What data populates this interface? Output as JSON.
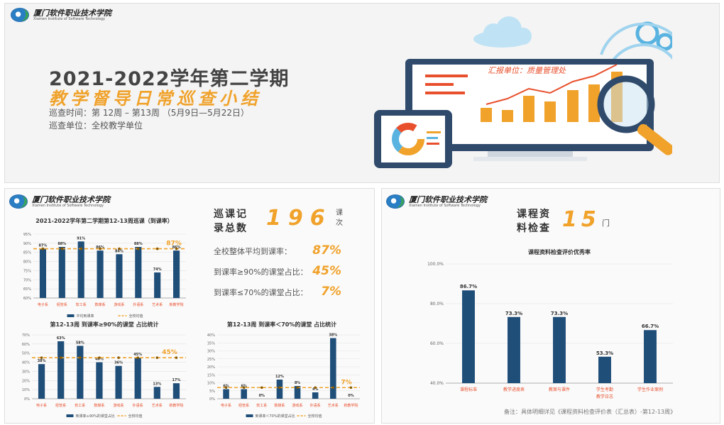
{
  "logo": {
    "cn": "厦门软件职业技术学院",
    "en": "Xiamen Institute of Software Technology"
  },
  "cover": {
    "title": "2021-2022学年第二学期",
    "subtitle": "教学督导日常巡查小结",
    "time_line": "巡查时间：第 12周 – 第13周 （5月9日—5月22日）",
    "unit_line": "巡查单位：全校教学单位",
    "screen_banner": "汇报单位：质量管理处"
  },
  "left_slide": {
    "stat_label": "巡课记录总数",
    "stat_value": "196",
    "stat_unit": "课次",
    "stats": [
      {
        "label": "全校整体平均到课率：",
        "value": "87%"
      },
      {
        "label": "到课率≥90%的课堂占比：",
        "value": "45%"
      },
      {
        "label": "到课率≤70%的课堂占比：",
        "value": "7%"
      }
    ]
  },
  "right_slide": {
    "stat_label": "课程资料检查",
    "stat_value": "15",
    "stat_unit": "门",
    "note": "备注：具体明细详见《课程资料检查评价表（汇总表）-第12-13周》"
  },
  "chart_data": [
    {
      "type": "bar",
      "title": "2021-2022学年第二学期第12-13周巡课（到课率）",
      "categories": [
        "电子系",
        "经管系",
        "软工系",
        "数媒系",
        "游戏系",
        "外语系",
        "艺术系",
        "新教学院"
      ],
      "series": [
        {
          "name": "平均到课率",
          "values": [
            87,
            88,
            91,
            86,
            84,
            88,
            74,
            86
          ]
        }
      ],
      "ref_line": {
        "name": "全校均值",
        "value": 87,
        "label": "87%"
      },
      "data_labels": [
        "87%",
        "88%",
        "91%",
        "86%",
        "84%",
        "88%",
        "74%",
        "86%"
      ],
      "yticks": [
        "60%",
        "65%",
        "70%",
        "75%",
        "80%",
        "85%",
        "90%",
        "95%"
      ],
      "ylim": [
        60,
        95
      ]
    },
    {
      "type": "bar",
      "title": "第12-13周 到课率≥90%的课堂 占比统计",
      "categories": [
        "电子系",
        "经管系",
        "软工系",
        "数媒系",
        "游戏系",
        "外语系",
        "艺术系",
        "新教学院"
      ],
      "series": [
        {
          "name": "到课率≥90%的课堂占比",
          "values": [
            38,
            63,
            58,
            40,
            36,
            45,
            13,
            17
          ]
        }
      ],
      "ref_line": {
        "name": "全校均值",
        "value": 45,
        "label": "45%"
      },
      "data_labels": [
        "38%",
        "63%",
        "58%",
        "40%",
        "36%",
        "45%",
        "13%",
        "17%"
      ],
      "yticks": [
        "0%",
        "10%",
        "20%",
        "30%",
        "40%",
        "50%",
        "60%",
        "70%"
      ],
      "ylim": [
        0,
        70
      ]
    },
    {
      "type": "bar",
      "title": "第12-13周 到课率＜70%的课堂 占比统计",
      "categories": [
        "电子系",
        "经管系",
        "软工系",
        "数媒系",
        "游戏系",
        "外语系",
        "艺术系",
        "新教学院"
      ],
      "series": [
        {
          "name": "到课率＜70%的课堂占比",
          "values": [
            6,
            6,
            0,
            12,
            8,
            4,
            38,
            0
          ]
        }
      ],
      "ref_line": {
        "name": "全校均值",
        "value": 7,
        "label": "7%"
      },
      "data_labels": [
        "6%",
        "6%",
        "0%",
        "12%",
        "8%",
        "4%",
        "38%",
        "0%"
      ],
      "yticks": [
        "0%",
        "5%",
        "10%",
        "15%",
        "20%",
        "25%",
        "30%",
        "35%",
        "40%"
      ],
      "ylim": [
        0,
        40
      ]
    },
    {
      "type": "bar",
      "title": "课程资料检查评价优秀率",
      "categories": [
        "课程标准",
        "教学进度表",
        "教案与课件",
        "学生考勤 教学日志",
        "学生作业案例"
      ],
      "series": [
        {
          "name": "优秀率",
          "values": [
            86.7,
            73.3,
            73.3,
            53.3,
            66.7
          ]
        }
      ],
      "data_labels": [
        "86.7%",
        "73.3%",
        "73.3%",
        "53.3%",
        "66.7%"
      ],
      "yticks": [
        "40.0%",
        "60.0%",
        "80.0%",
        "100.0%"
      ],
      "ylim": [
        40,
        100
      ]
    }
  ]
}
